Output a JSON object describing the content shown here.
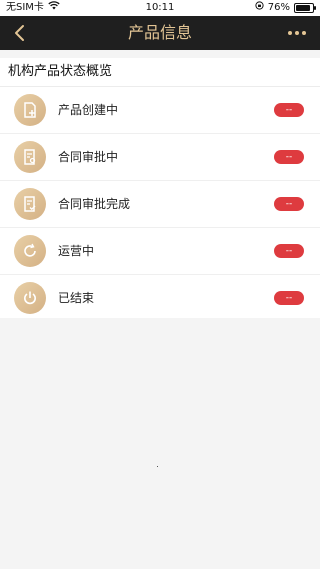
{
  "statusbar": {
    "carrier": "无SIM卡",
    "time": "10:11",
    "battery": "76%"
  },
  "navbar": {
    "title": "产品信息"
  },
  "section": {
    "title": "机构产品状态概览",
    "rows": [
      {
        "label": "产品创建中",
        "badge": "--",
        "icon": "file-add-icon"
      },
      {
        "label": "合同审批中",
        "badge": "--",
        "icon": "document-review-icon"
      },
      {
        "label": "合同审批完成",
        "badge": "--",
        "icon": "document-check-icon"
      },
      {
        "label": "运营中",
        "badge": "--",
        "icon": "refresh-cycle-icon"
      },
      {
        "label": "已结束",
        "badge": "--",
        "icon": "power-icon"
      }
    ]
  },
  "colors": {
    "accent": "#e3c595",
    "nav_bg": "#1f1f1f",
    "badge": "#de3b3f",
    "icon_bg": "#dcbc8f"
  }
}
